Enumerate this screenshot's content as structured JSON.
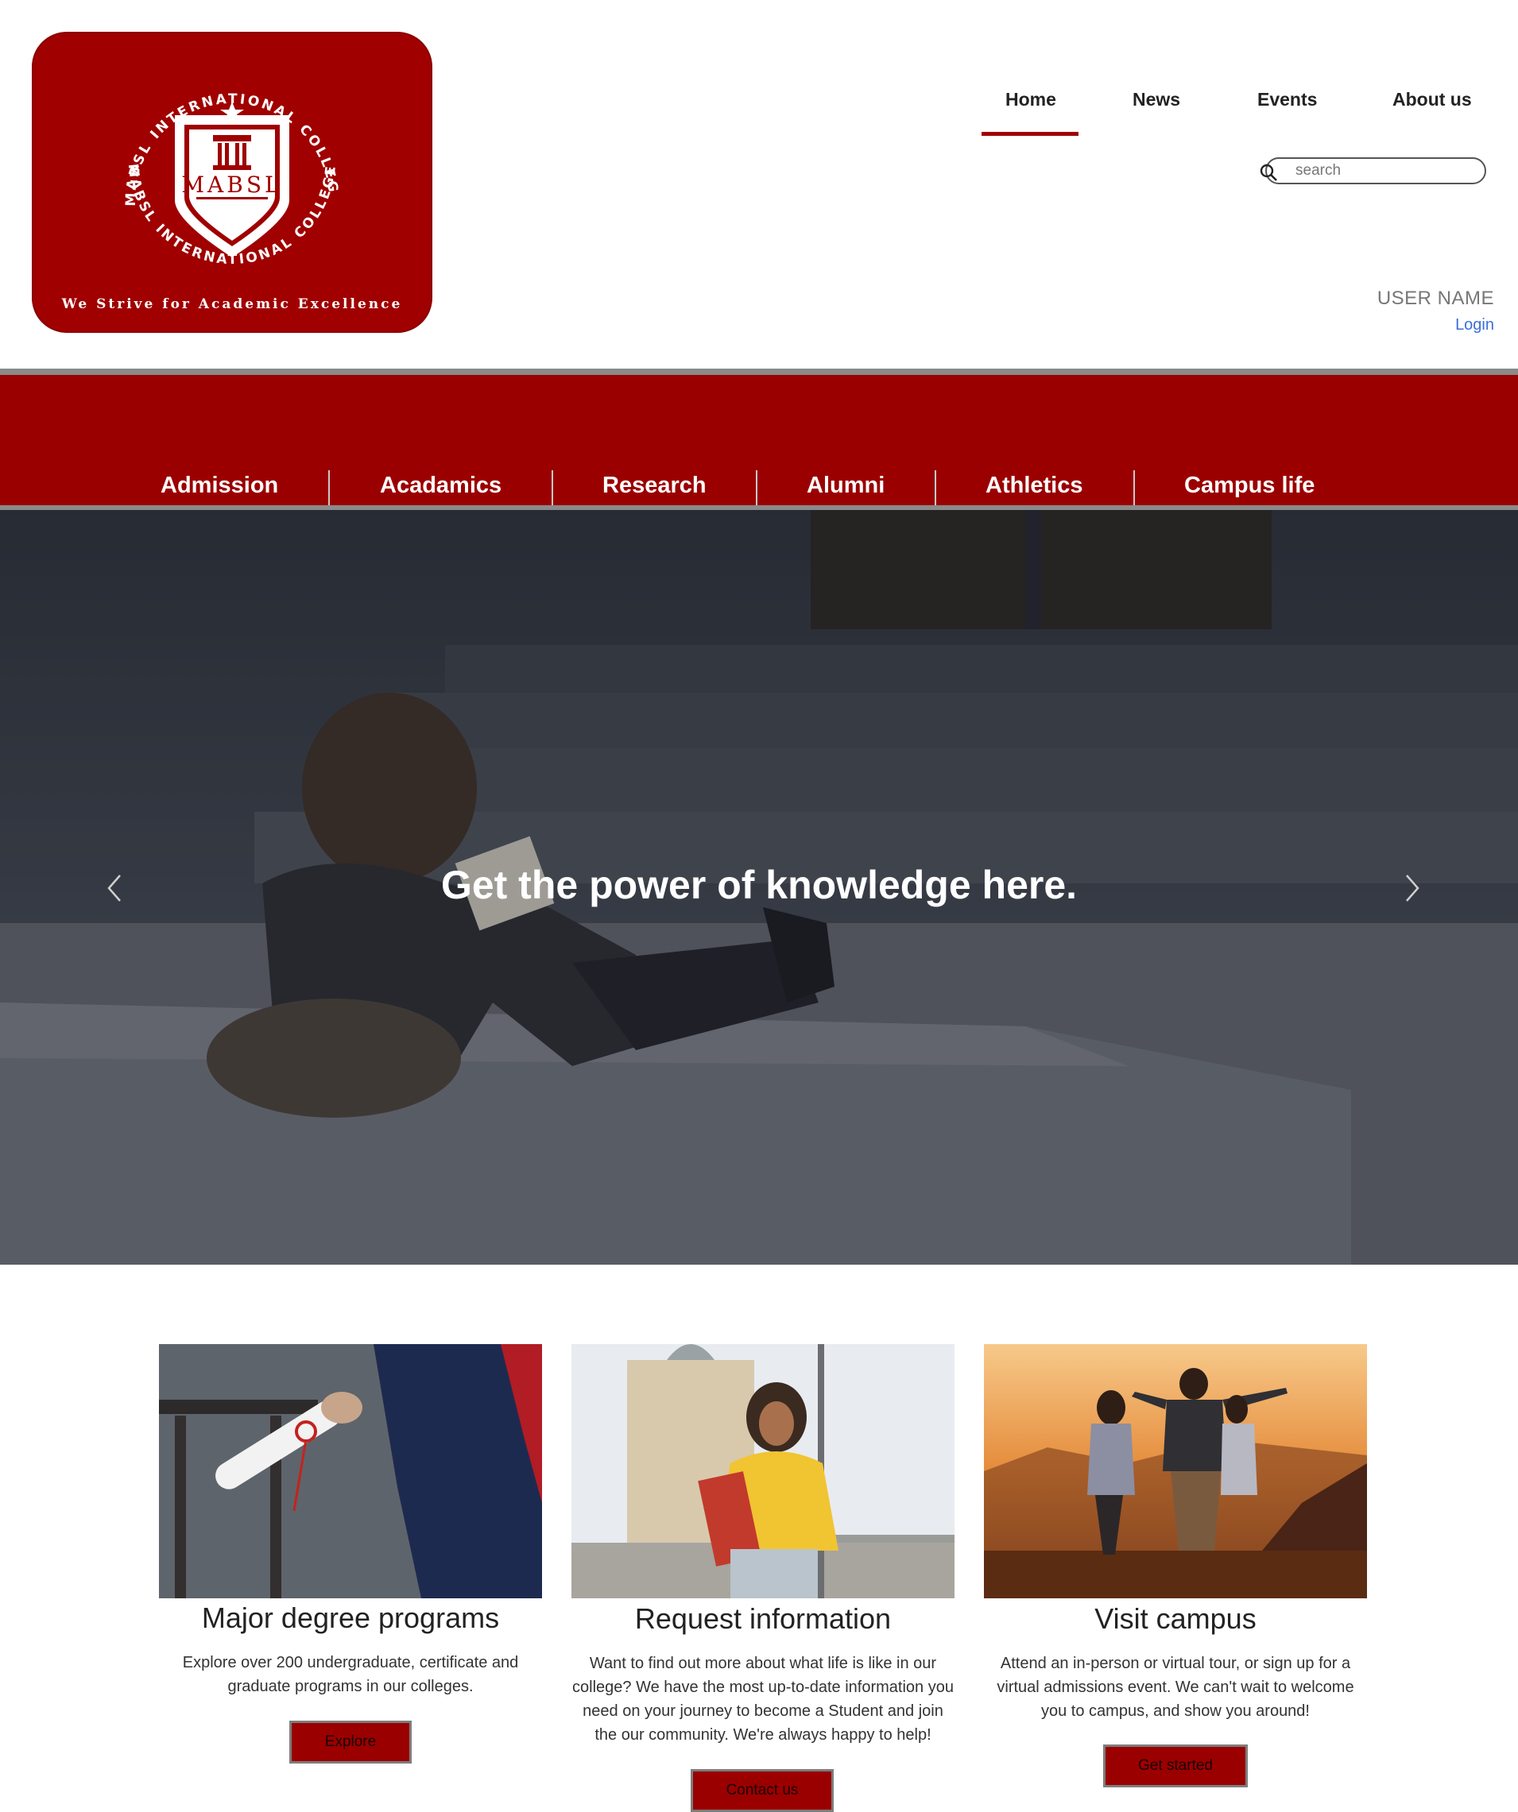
{
  "logo": {
    "ring_text_top": "MABSL INTERNATIONAL COLLEGE",
    "ring_text_bottom": "MABSL INTERNATIONAL COLLEGE",
    "shield_text": "MABSL",
    "motto": "We Strive for Academic Excellence"
  },
  "top_nav": {
    "items": [
      {
        "label": "Home",
        "active": true
      },
      {
        "label": "News"
      },
      {
        "label": "Events"
      },
      {
        "label": "About us"
      }
    ]
  },
  "search": {
    "placeholder": "search"
  },
  "user": {
    "name": "USER NAME",
    "login_label": "Login"
  },
  "main_nav": {
    "items": [
      "Admission",
      "Acadamics",
      "Research",
      "Alumni",
      "Athletics",
      "Campus life"
    ]
  },
  "hero": {
    "title": "Get the power of knowledge here."
  },
  "cards": [
    {
      "title": "Major degree programs",
      "text": "Explore over 200 undergraduate, certificate and graduate programs in our colleges.",
      "button": "Explore"
    },
    {
      "title": "Request information",
      "text": "Want to find out more about what life is like in our college? We have the most up-to-date information you need on your journey to become a Student and join the our community. We're always happy to help!",
      "button": "Contact us"
    },
    {
      "title": "Visit campus",
      "text": "Attend an in-person or virtual tour, or sign up for a virtual admissions event. We can't wait to welcome you to campus, and show you around!",
      "button": "Get started"
    }
  ],
  "colors": {
    "brand": "#9b0000",
    "link": "#3b6fd8",
    "divider": "#8a8a8a"
  }
}
